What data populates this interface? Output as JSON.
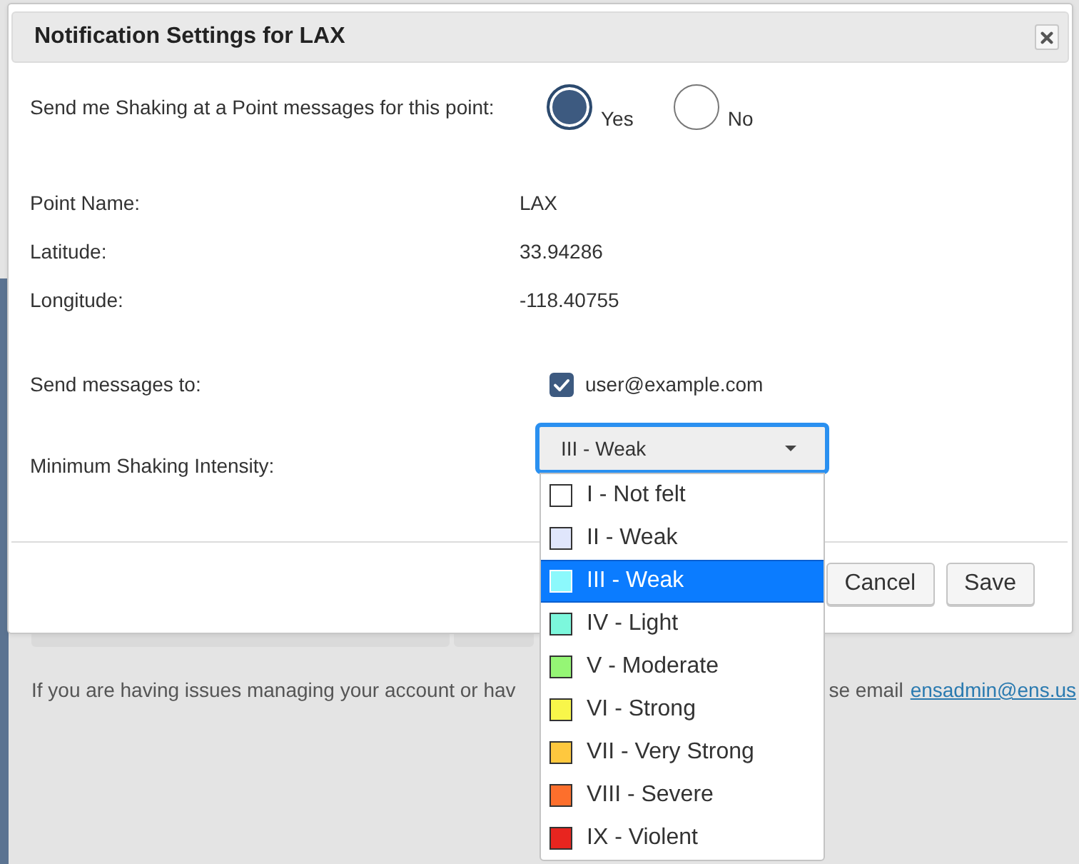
{
  "dialog": {
    "title": "Notification Settings for LAX",
    "subscribe": {
      "label": "Send me Shaking at a Point messages for this point:",
      "options": [
        {
          "label": "Yes",
          "selected": true
        },
        {
          "label": "No",
          "selected": false
        }
      ]
    },
    "details": [
      {
        "label": "Point Name:",
        "value": "LAX"
      },
      {
        "label": "Latitude:",
        "value": "33.94286"
      },
      {
        "label": "Longitude:",
        "value": "-118.40755"
      }
    ],
    "recipients": {
      "label": "Send messages to:",
      "items": [
        {
          "address": "user@example.com",
          "checked": true
        }
      ]
    },
    "intensity": {
      "label": "Minimum Shaking Intensity:",
      "value": "III - Weak",
      "expanded": true,
      "options": [
        {
          "label": "I - Not felt",
          "color": "#ffffff",
          "selected": false
        },
        {
          "label": "II - Weak",
          "color": "#e0e6fc",
          "selected": false
        },
        {
          "label": "III - Weak",
          "color": "#8cf9fc",
          "selected": true
        },
        {
          "label": "IV - Light",
          "color": "#7cf7dc",
          "selected": false
        },
        {
          "label": "V - Moderate",
          "color": "#95f675",
          "selected": false
        },
        {
          "label": "VI - Strong",
          "color": "#f8f64a",
          "selected": false
        },
        {
          "label": "VII - Very Strong",
          "color": "#fec83e",
          "selected": false
        },
        {
          "label": "VIII - Severe",
          "color": "#fd6f2c",
          "selected": false
        },
        {
          "label": "IX - Violent",
          "color": "#e8251f",
          "selected": false
        }
      ]
    },
    "buttons": [
      "Cancel",
      "Save"
    ]
  },
  "page": {
    "help_text_start": "If you are having issues managing your account or hav",
    "help_text_end": "se email",
    "help_link": "ensadmin@ens.us"
  }
}
